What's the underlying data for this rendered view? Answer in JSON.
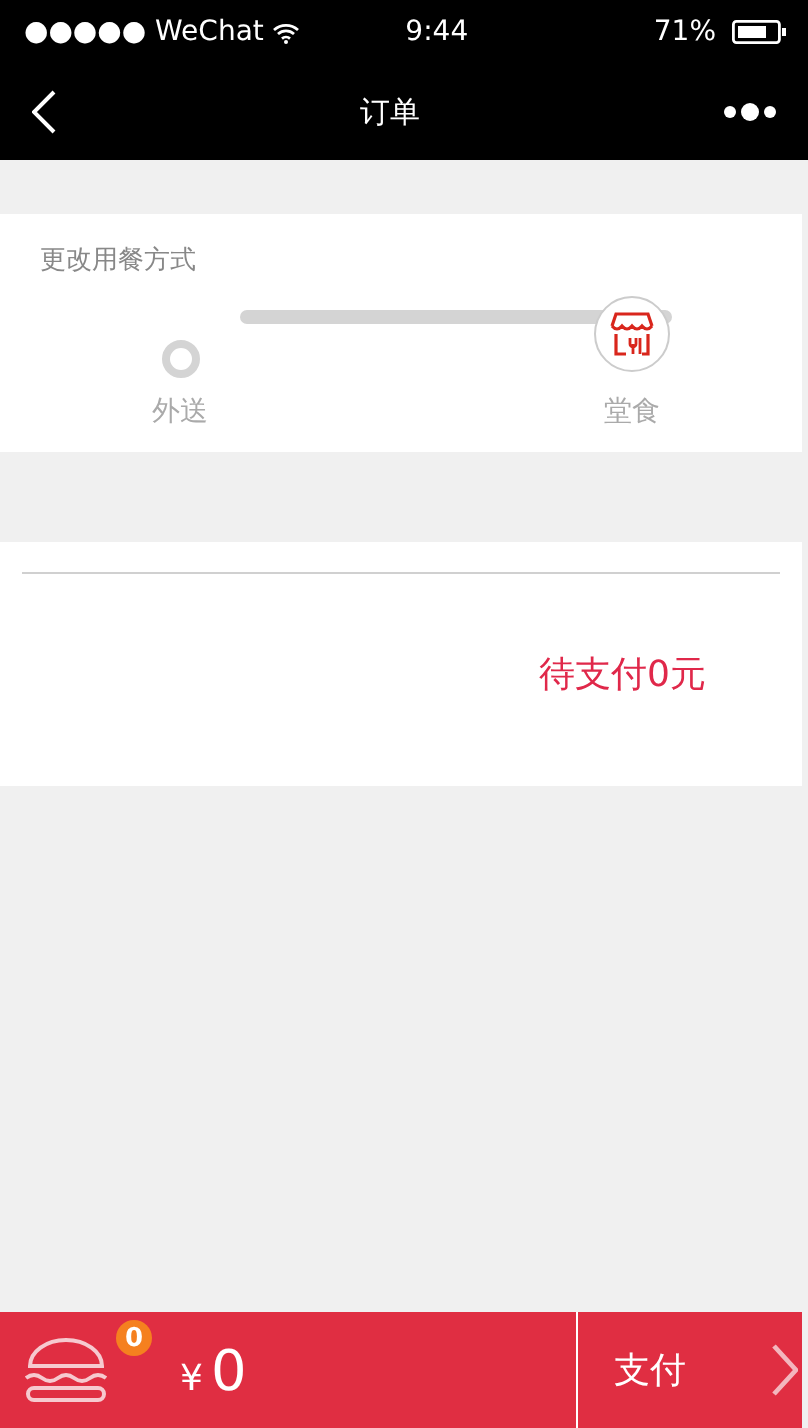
{
  "status_bar": {
    "carrier": "●●●●● WeChat",
    "time": "9:44",
    "battery": "71%"
  },
  "nav": {
    "title": "订单"
  },
  "dining": {
    "title": "更改用餐方式",
    "options": [
      {
        "label": "外送",
        "selected": false
      },
      {
        "label": "堂食",
        "selected": true
      }
    ]
  },
  "order": {
    "status": "待支付0元"
  },
  "footer": {
    "badge": "0",
    "currency": "¥",
    "total": "0",
    "pay": "支付"
  }
}
